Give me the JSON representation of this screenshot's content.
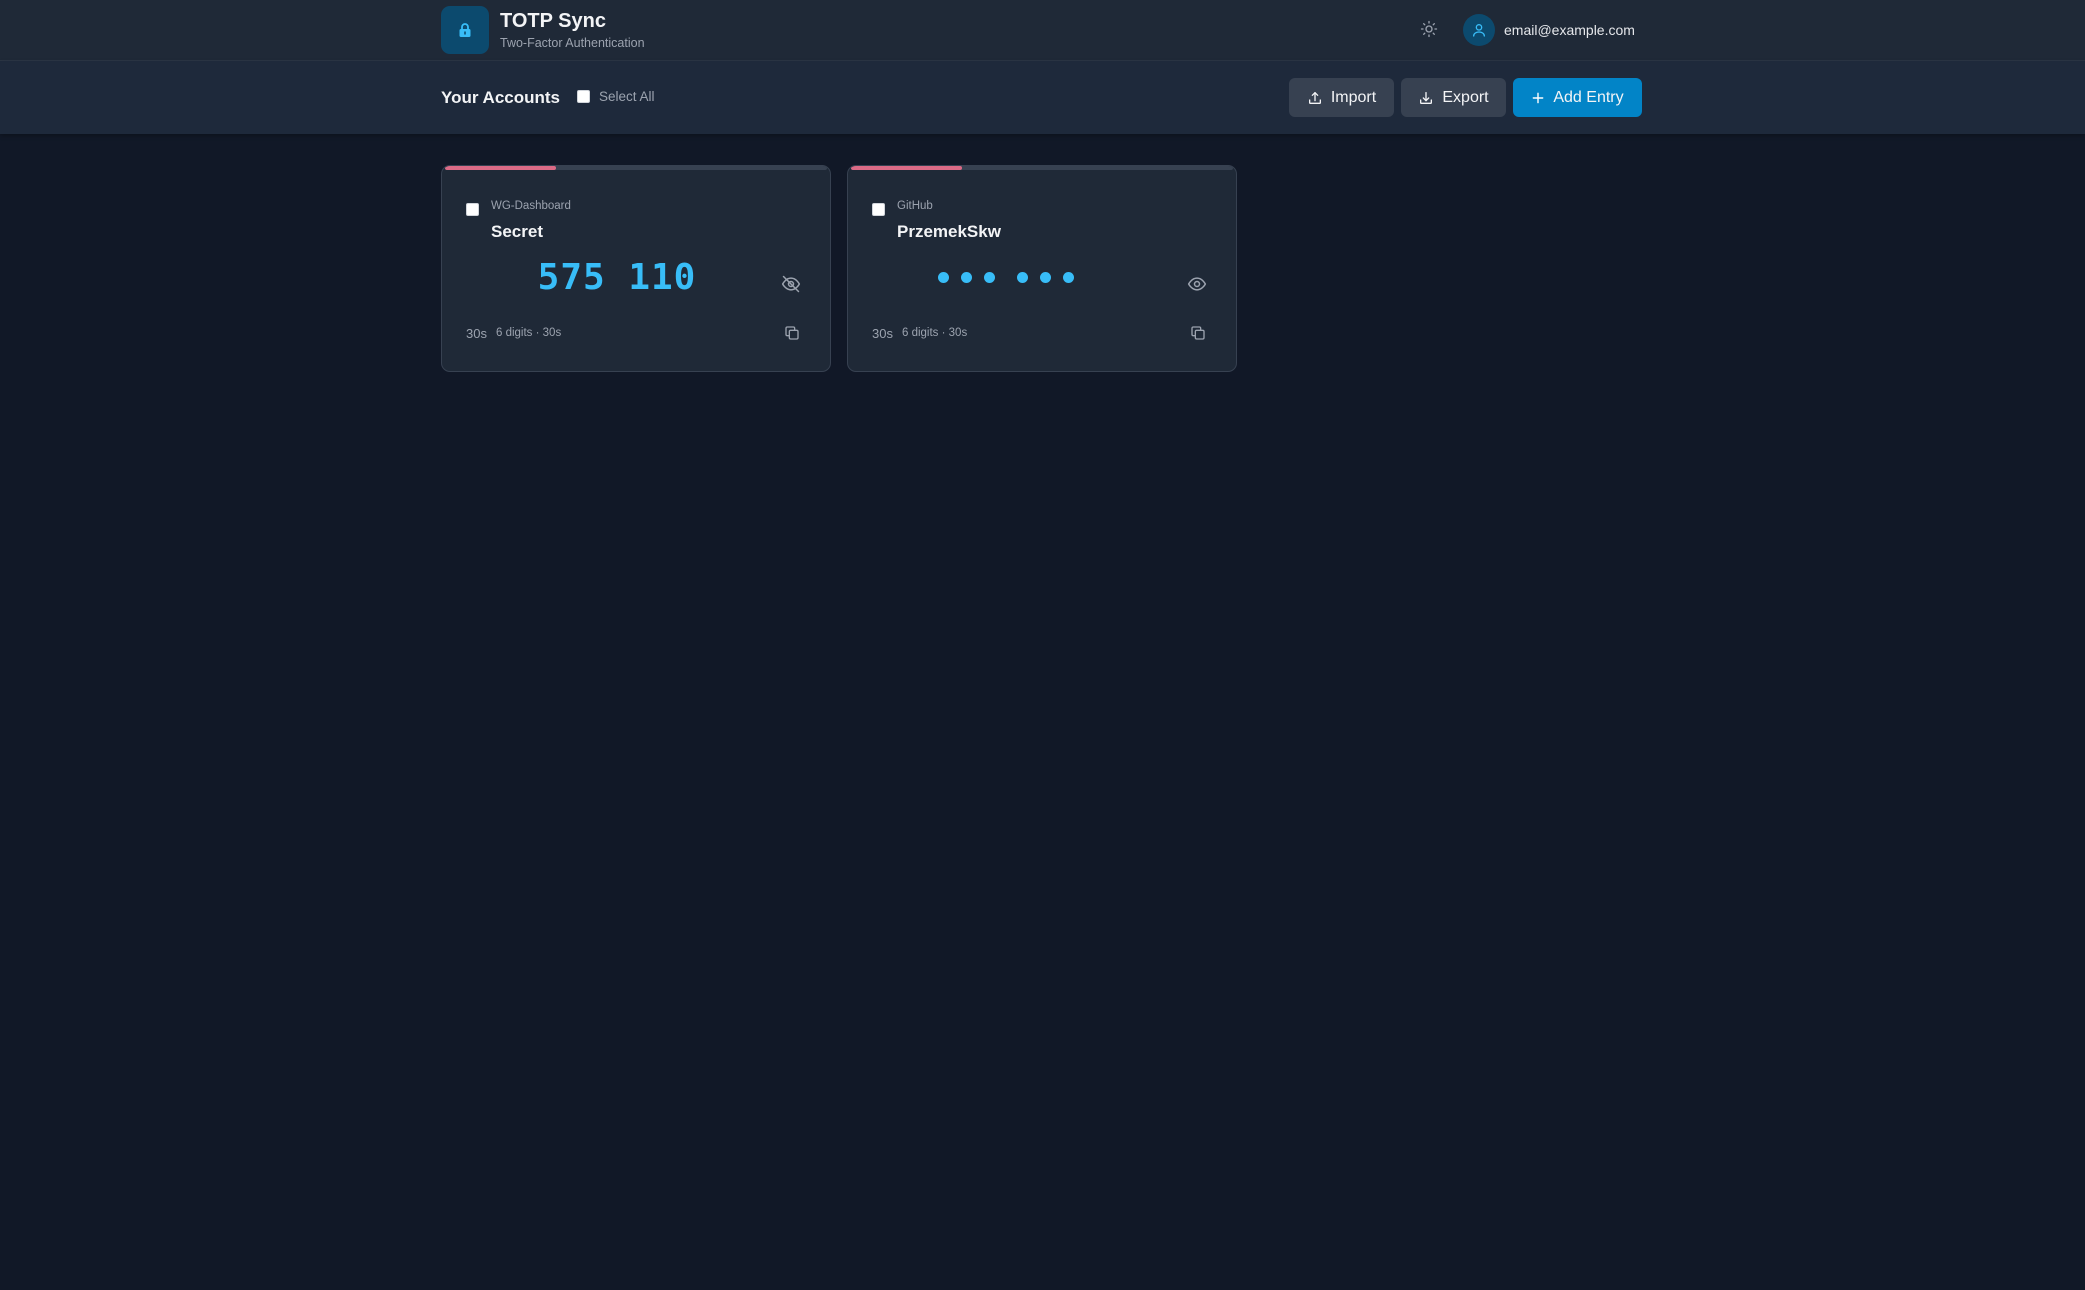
{
  "app": {
    "title": "TOTP Sync",
    "subtitle": "Two-Factor Authentication",
    "logo_icon": "lock-icon",
    "theme_icon": "sun-icon",
    "user_email": "email@example.com",
    "user_icon": "user-icon"
  },
  "toolbar": {
    "title": "Your Accounts",
    "select_all_label": "Select All",
    "select_all_checked": false,
    "import_label": "Import",
    "import_icon": "upload-icon",
    "export_label": "Export",
    "export_icon": "download-icon",
    "add_label": "Add Entry",
    "add_icon": "plus-icon"
  },
  "entries": [
    {
      "issuer": "WG-Dashboard",
      "account": "Secret",
      "code": "575 110",
      "code_visible": true,
      "visibility_icon": "eye-off-icon",
      "remaining": "30s",
      "meta": "6 digits · 30s",
      "copy_icon": "copy-icon",
      "progress_fraction": 0.29,
      "checked": false
    },
    {
      "issuer": "GitHub",
      "account": "PrzemekSkw",
      "code": "",
      "code_visible": false,
      "visibility_icon": "eye-icon",
      "remaining": "30s",
      "meta": "6 digits · 30s",
      "copy_icon": "copy-icon",
      "progress_fraction": 0.29,
      "checked": false
    }
  ],
  "colors": {
    "background": "#111827",
    "header": "#1f2937",
    "accent": "#0284c7",
    "code": "#38bdf8",
    "progress": "#db6a86"
  }
}
